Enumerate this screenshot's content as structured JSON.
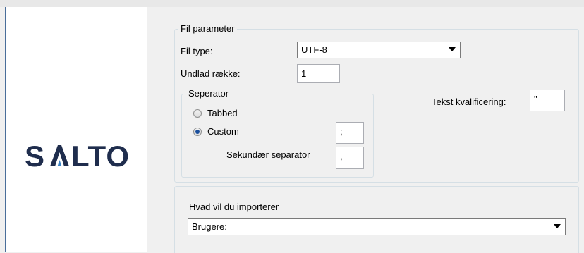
{
  "brand": {
    "logo_text": "SALTO"
  },
  "file_params": {
    "legend": "Fil parameter",
    "file_type_label": "Fil type:",
    "file_type_value": "UTF-8",
    "skip_rows_label": "Undlad række:",
    "skip_rows_value": "1",
    "text_qualifier_label": "Tekst kvalificering:",
    "text_qualifier_value": "\""
  },
  "separator": {
    "legend": "Seperator",
    "option_tabbed": "Tabbed",
    "option_custom": "Custom",
    "custom_value": ";",
    "secondary_label": "Sekundær separator",
    "secondary_value": ","
  },
  "import": {
    "label": "Hvad vil du importerer",
    "selected": "Brugere:"
  }
}
